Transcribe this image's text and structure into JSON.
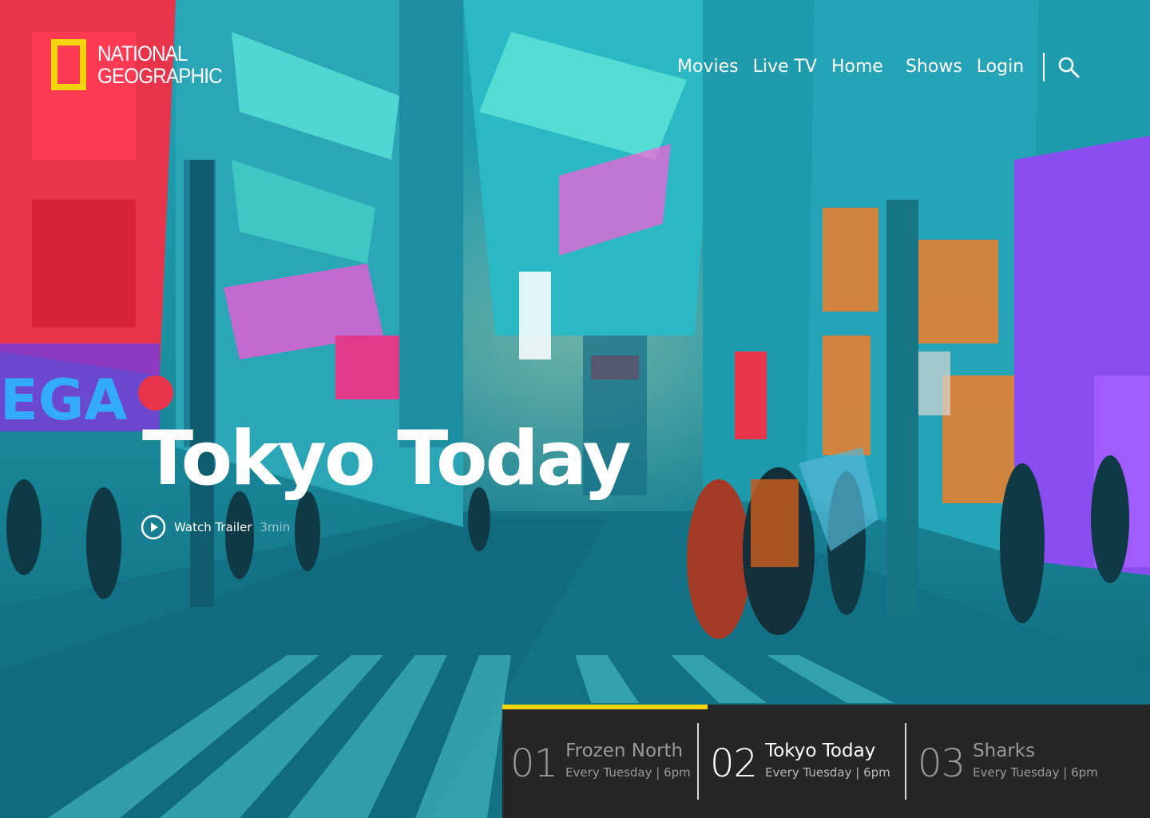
{
  "brand": {
    "name_line1": "NATIONAL",
    "name_line2": "GEOGRAPHIC",
    "frame_color": "#f6d40a"
  },
  "nav": {
    "items": [
      "Movies",
      "Live TV",
      "Home",
      "Shows",
      "Login"
    ],
    "search_icon": "search-icon"
  },
  "hero": {
    "title": "Tokyo Today",
    "trailer_label": "Watch Trailer",
    "trailer_duration": "3min",
    "play_icon": "play-circle-icon"
  },
  "shows": [
    {
      "number": "01",
      "title": "Frozen North",
      "schedule": "Every Tuesday | 6pm",
      "active": false
    },
    {
      "number": "02",
      "title": "Tokyo Today",
      "schedule": "Every Tuesday | 6pm",
      "active": true
    },
    {
      "number": "03",
      "title": "Sharks",
      "schedule": "Every Tuesday | 6pm",
      "active": false
    }
  ],
  "colors": {
    "accent": "#f6d40a",
    "panel": "#262626"
  }
}
